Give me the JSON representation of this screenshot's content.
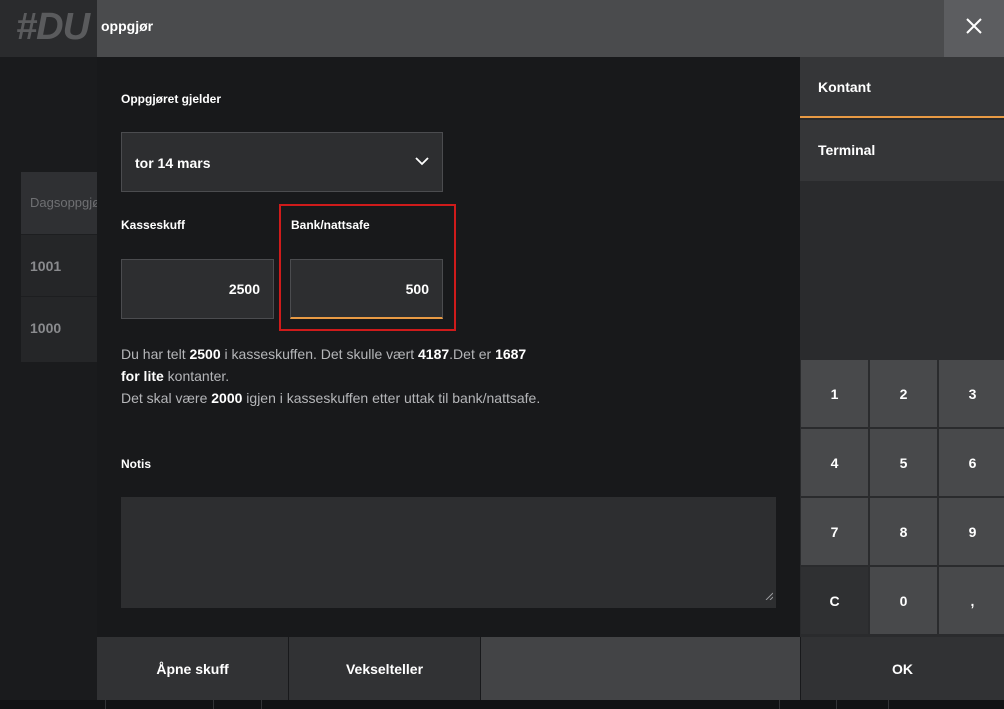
{
  "background": {
    "logo": "#DU",
    "table": {
      "header": "Dagsoppgjør",
      "rows": [
        "1001",
        "1000"
      ]
    }
  },
  "dialog": {
    "title": "oppgjør",
    "close_icon": "close-icon",
    "date_section": {
      "label": "Oppgjøret gjelder",
      "selected": "tor 14 mars"
    },
    "cash_drawer": {
      "label": "Kasseskuff",
      "value": "2500"
    },
    "bank_safe": {
      "label": "Bank/nattsafe",
      "value": "500"
    },
    "summary": {
      "t1": "Du har telt ",
      "v1": "2500",
      "t2": " i kasseskuffen. Det skulle vært ",
      "v2": "4187",
      "t3": ".Det er ",
      "v3": "1687",
      "v4": "for lite",
      "t4": " kontanter.",
      "t5": "Det skal være ",
      "v5": "2000",
      "t6": " igjen i kasseskuffen etter uttak til bank/nattsafe."
    },
    "notes": {
      "label": "Notis",
      "value": ""
    }
  },
  "actions": {
    "open_drawer": "Åpne skuff",
    "change_counter": "Vekselteller",
    "ok": "OK"
  },
  "payment_tabs": [
    {
      "label": "Kontant",
      "active": true
    },
    {
      "label": "Terminal",
      "active": false
    }
  ],
  "keypad": [
    "1",
    "2",
    "3",
    "4",
    "5",
    "6",
    "7",
    "8",
    "9",
    "C",
    "0",
    ","
  ],
  "colors": {
    "accent": "#e89a44",
    "highlight_border": "#cf1b1b",
    "dialog_bg": "#18191b",
    "titlebar": "#4a4b4d"
  }
}
